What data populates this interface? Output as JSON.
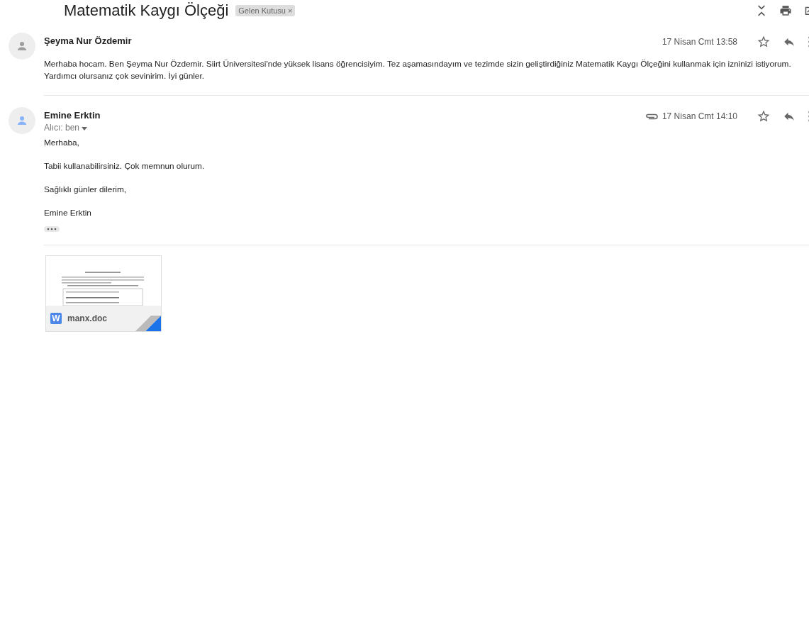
{
  "thread": {
    "subject": "Matematik Kaygı Ölçeği",
    "label": {
      "text": "Gelen Kutusu",
      "close": "×"
    }
  },
  "messages": [
    {
      "sender": "Şeyma Nur Özdemir",
      "color": "#9e9e9e",
      "has_attachment": false,
      "date": "17 Nisan Cmt 13:58",
      "starred": false,
      "body": [
        "Merhaba hocam. Ben Şeyma Nur Özdemir. Siirt Üniversitesi'nde yüksek lisans öğrencisiyim. Tez aşamasındayım ve tezimde sizin geliştirdiğiniz Matematik Kaygı Ölçeğini kullanmak için izninizi istiyorum. Yardımcı olursanız çok sevinirim. İyi günler."
      ],
      "show_trimmed": false
    },
    {
      "sender": "Emine Erktin",
      "color": "#8ab4f8",
      "has_attachment": true,
      "date": "17 Nisan Cmt 14:10",
      "starred": false,
      "recipient": "Alıcı: ben",
      "body": [
        "Merhaba,",
        "Tabii kullanabilirsiniz. Çok memnun olurum.",
        "Sağlıklı günler dilerim,",
        "Emine Erktin"
      ],
      "show_trimmed": true,
      "attachments": [
        {
          "type_letter": "W",
          "name": "manx.doc"
        }
      ]
    }
  ]
}
